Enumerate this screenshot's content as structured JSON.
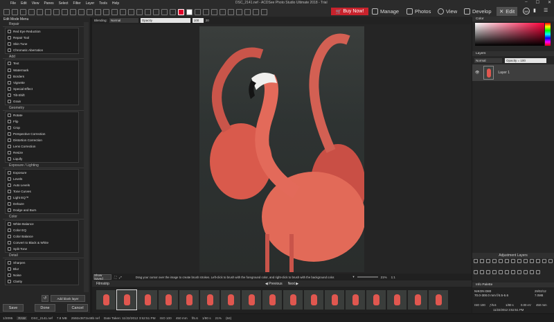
{
  "title_bar": {
    "menu": [
      "File",
      "Edit",
      "View",
      "Panes",
      "Select",
      "Filter",
      "Layer",
      "Tools",
      "Help"
    ],
    "window_title": "DSC_2141.nef - ACDSee Photo Studio Ultimate 2018 - Trial",
    "controls": [
      "–",
      "☐",
      "✕"
    ]
  },
  "toolbar": {
    "buy_now": "Buy Now!",
    "tooltip": "Buy Now!",
    "modes": {
      "manage": "Manage",
      "photos": "Photos",
      "view": "View",
      "develop": "Develop",
      "edit": "Edit"
    },
    "badge": "365"
  },
  "options_bar": {
    "blending_label": "Blending:",
    "blending_value": "Normal",
    "opacity_label": "Opacity",
    "opacity_value": "100",
    "extra": "20"
  },
  "left_panel": {
    "header": "Edit Mode Menu",
    "groups": [
      {
        "title": "Repair",
        "items": [
          "Red Eye Reduction",
          "Repair Tool",
          "Skin Tune",
          "Chromatic Aberration"
        ]
      },
      {
        "title": "Add",
        "items": [
          "Text",
          "Watermark",
          "Borders",
          "Vignette",
          "Special Effect",
          "Tilt-Shift",
          "Grain"
        ]
      },
      {
        "title": "Geometry",
        "items": [
          "Rotate",
          "Flip",
          "Crop",
          "Perspective Correction",
          "Distortion Correction",
          "Lens Correction",
          "Resize",
          "Liquify"
        ]
      },
      {
        "title": "Exposure / Lighting",
        "items": [
          "Exposure",
          "Levels",
          "Auto Levels",
          "Tone Curves",
          "Light EQ™",
          "Dehaze",
          "Dodge and Burn"
        ]
      },
      {
        "title": "Color",
        "items": [
          "White Balance",
          "Color EQ",
          "Color Balance",
          "Convert to Black & White",
          "Split Tone"
        ]
      },
      {
        "title": "Detail",
        "items": [
          "Sharpen",
          "Blur",
          "Noise",
          "Clarity"
        ]
      }
    ],
    "add_blank_layer": "Add blank layer",
    "save": "Save",
    "done": "Done",
    "cancel": "Cancel"
  },
  "canvas": {
    "show_saved": "Show Saved",
    "hint": "Drag your cursor over the image to create brush strokes. Left-click to brush with the foreground color, and right-click to brush with the background color.",
    "zoom": "21%",
    "zoom_ratio": "1:1"
  },
  "filmstrip": {
    "label": "Filmstrip",
    "previous": "Previous",
    "next": "Next",
    "count": 17
  },
  "right_panel": {
    "color_header": "Color",
    "layers_header": "Layers",
    "blend_mode": "Normal",
    "opacity": "Opacity = 100",
    "layer_name": "Layer 1",
    "adjustment_layers": "Adjustment Layers",
    "info_palette": "Info Palette",
    "info": {
      "camera": "NIKON D80",
      "lens": "70.0-300.0 mm f/4.5-5.6",
      "file_date": "29/02/12",
      "focal": "7.0MB",
      "iso": "ISO 100",
      "aperture": "ƒ/5.6",
      "shutter": "1/80 s",
      "ev": "0.00 eV",
      "mm": "450 mm",
      "date": "11/22/2012 3:52:51 PM"
    },
    "accent": "#c8222c"
  },
  "status_bar": {
    "index": "1/2095",
    "format": "RAW",
    "filename": "DSC_2141.nef",
    "size": "7.8 MB",
    "dims": "2592x3872x48b nef",
    "date_taken": "Date Taken: 11/22/2012 3:52:51 PM",
    "iso": "ISO 100",
    "focal": "450 mm",
    "fstop": "f/5.6",
    "shutter": "1/80 s",
    "zoom": "21%",
    "extra": "(84)"
  }
}
